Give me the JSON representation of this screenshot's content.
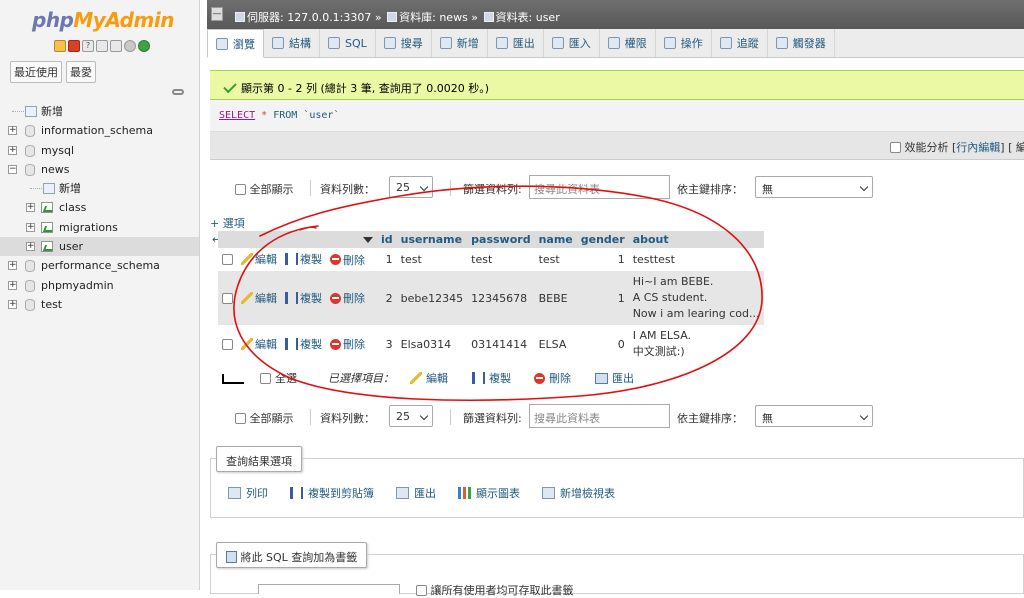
{
  "nav": {
    "logo_php": "php",
    "logo_my": "MyAdmin",
    "tab_recent": "最近使用",
    "tab_favorites": "最愛",
    "tree": [
      {
        "label": "新增",
        "type": "new",
        "level": 0
      },
      {
        "label": "information_schema",
        "type": "db",
        "level": 0
      },
      {
        "label": "mysql",
        "type": "db",
        "level": 0
      },
      {
        "label": "news",
        "type": "db",
        "level": 0,
        "expanded": true
      },
      {
        "label": "新增",
        "type": "new",
        "level": 1
      },
      {
        "label": "class",
        "type": "table",
        "level": 1
      },
      {
        "label": "migrations",
        "type": "table",
        "level": 1
      },
      {
        "label": "user",
        "type": "table",
        "level": 1,
        "selected": true
      },
      {
        "label": "performance_schema",
        "type": "db",
        "level": 0
      },
      {
        "label": "phpmyadmin",
        "type": "db",
        "level": 0
      },
      {
        "label": "test",
        "type": "db",
        "level": 0
      }
    ]
  },
  "breadcrumb": {
    "server": "伺服器: 127.0.0.1:3307",
    "database": "資料庫: news",
    "table": "資料表: user"
  },
  "tabs": [
    "瀏覽",
    "結構",
    "SQL",
    "搜尋",
    "新增",
    "匯出",
    "匯入",
    "權限",
    "操作",
    "追蹤",
    "觸發器"
  ],
  "success_message": "顯示第 0 - 2 列 (總計 3 筆, 查詢用了 0.0020 秒。)",
  "sql": {
    "keyword": "SELECT",
    "star": "*",
    "from": "FROM",
    "ident": "`user`"
  },
  "profiling": {
    "label": "效能分析",
    "bracket_open": "[",
    "inline_edit": "行內編輯",
    "tail": "] [ 編"
  },
  "nav_controls": {
    "show_all": "全部顯示",
    "rows_label": "資料列數：",
    "rows_value": "25",
    "filter_label": "篩選資料列:",
    "filter_placeholder": "搜尋此資料表",
    "sort_label": "依主鍵排序：",
    "sort_value": "無"
  },
  "options_link": "+ 選項",
  "sort_arrows": "←T→",
  "table": {
    "columns": [
      "id",
      "username",
      "password",
      "name",
      "gender",
      "about"
    ],
    "actions": {
      "edit": "編輯",
      "copy": "複製",
      "delete": "刪除"
    },
    "rows": [
      {
        "id": "1",
        "username": "test",
        "password": "test",
        "name": "test",
        "gender": "1",
        "about": [
          "testtest"
        ]
      },
      {
        "id": "2",
        "username": "bebe12345",
        "password": "12345678",
        "name": "BEBE",
        "gender": "1",
        "about": [
          "Hi~I am BEBE.",
          "A CS student.",
          "Now i am learing cod..."
        ]
      },
      {
        "id": "3",
        "username": "Elsa0314",
        "password": "03141414",
        "name": "ELSA",
        "gender": "0",
        "about": [
          "I AM ELSA.",
          "中文測試:)"
        ]
      }
    ]
  },
  "bulk": {
    "select_all": "全選",
    "with_selected": "已選擇項目：",
    "edit": "編輯",
    "copy": "複製",
    "delete": "刪除",
    "export": "匯出"
  },
  "query_results": {
    "legend": "查詢結果選項",
    "print": "列印",
    "copy_clipboard": "複製到剪貼簿",
    "export": "匯出",
    "chart": "顯示圖表",
    "create_view": "新增檢視表"
  },
  "bookmark": {
    "legend": "將此 SQL 查詢加為書籤",
    "note": "讓所有使用者均可存取此書籤"
  }
}
